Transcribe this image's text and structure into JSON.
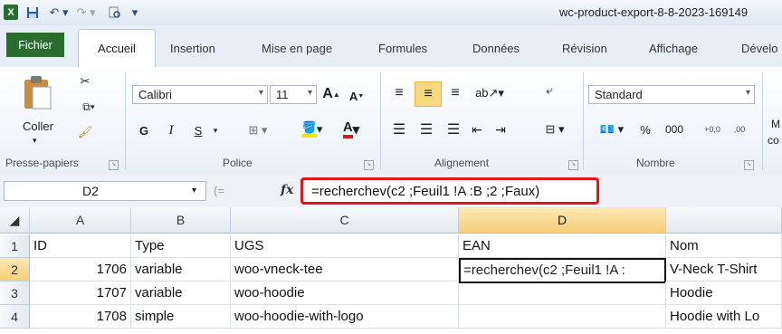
{
  "window": {
    "title": "wc-product-export-8-8-2023-169149"
  },
  "ribbon_tabs": [
    "Fichier",
    "Accueil",
    "Insertion",
    "Mise en page",
    "Formules",
    "Données",
    "Révision",
    "Affichage",
    "Dévelo"
  ],
  "clipboard": {
    "paste_label": "Coller",
    "group_label": "Presse-papiers"
  },
  "font": {
    "name": "Calibri",
    "size": "11",
    "bold": "G",
    "italic": "I",
    "underline": "S",
    "group_label": "Police"
  },
  "alignment": {
    "group_label": "Alignement"
  },
  "number": {
    "format": "Standard",
    "percent": "%",
    "thousands": "000",
    "inc_decimal": "+0,0",
    "dec_decimal": ",00",
    "group_label": "Nombre"
  },
  "more_label": "M",
  "more_label2": "co",
  "formula_bar": {
    "name_box": "D2",
    "fx": "fx",
    "formula": "=recherchev(c2 ;Feuil1 !A :B ;2 ;Faux)"
  },
  "grid": {
    "columns": [
      "A",
      "B",
      "C",
      "D"
    ],
    "rows": [
      "1",
      "2",
      "3",
      "4"
    ],
    "header_row": {
      "A": "ID",
      "B": "Type",
      "C": "UGS",
      "D": "EAN",
      "E": "Nom"
    },
    "data": [
      {
        "A": "1706",
        "B": "variable",
        "C": "woo-vneck-tee",
        "D": "=recherchev(c2 ;Feuil1 !A :",
        "E": "V-Neck T-Shirt"
      },
      {
        "A": "1707",
        "B": "variable",
        "C": "woo-hoodie",
        "D": "",
        "E": "Hoodie"
      },
      {
        "A": "1708",
        "B": "simple",
        "C": "woo-hoodie-with-logo",
        "D": "",
        "E": "Hoodie with Lo"
      }
    ]
  },
  "colors": {
    "excel_green": "#2a6e2f",
    "highlight": "#e0161c",
    "selected_header": "#f6cf78"
  }
}
